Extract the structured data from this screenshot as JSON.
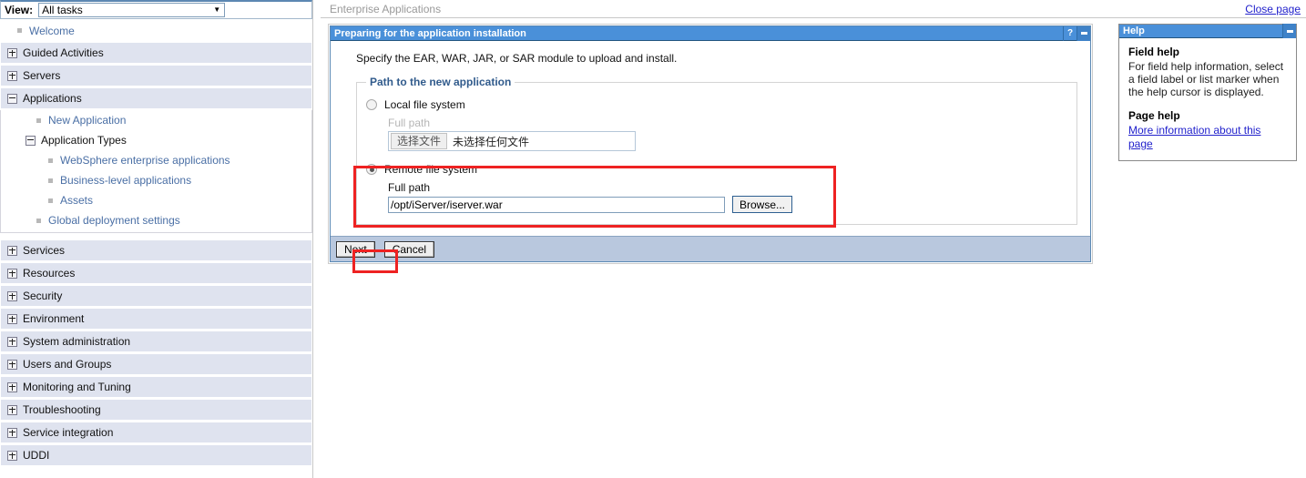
{
  "colors": {
    "panel_title_bg": "#4a90d9",
    "nav_group_bg": "#dfe3ef",
    "action_bar_bg": "#b9c8de",
    "link": "#4a6fa5",
    "annotation_red": "#ee2222",
    "legend_blue": "#315b8c"
  },
  "sidebar": {
    "view_label": "View:",
    "view_value": "All tasks",
    "caret_icon": "chevron-down-icon",
    "welcome": "Welcome",
    "groups": [
      {
        "label": "Guided Activities",
        "state": "collapsed",
        "icon": "plus-box-icon"
      },
      {
        "label": "Servers",
        "state": "collapsed",
        "icon": "plus-box-icon"
      },
      {
        "label": "Applications",
        "state": "expanded",
        "icon": "minus-box-icon"
      },
      {
        "label": "Services",
        "state": "collapsed",
        "icon": "plus-box-icon"
      },
      {
        "label": "Resources",
        "state": "collapsed",
        "icon": "plus-box-icon"
      },
      {
        "label": "Security",
        "state": "collapsed",
        "icon": "plus-box-icon"
      },
      {
        "label": "Environment",
        "state": "collapsed",
        "icon": "plus-box-icon"
      },
      {
        "label": "System administration",
        "state": "collapsed",
        "icon": "plus-box-icon"
      },
      {
        "label": "Users and Groups",
        "state": "collapsed",
        "icon": "plus-box-icon"
      },
      {
        "label": "Monitoring and Tuning",
        "state": "collapsed",
        "icon": "plus-box-icon"
      },
      {
        "label": "Troubleshooting",
        "state": "collapsed",
        "icon": "plus-box-icon"
      },
      {
        "label": "Service integration",
        "state": "collapsed",
        "icon": "plus-box-icon"
      },
      {
        "label": "UDDI",
        "state": "collapsed",
        "icon": "plus-box-icon"
      }
    ],
    "applications_children": {
      "new_application": "New Application",
      "application_types": "Application Types",
      "types": [
        "WebSphere enterprise applications",
        "Business-level applications",
        "Assets"
      ],
      "global_deployment_settings": "Global deployment settings"
    }
  },
  "topbar": {
    "breadcrumb": "Enterprise Applications",
    "close_page": "Close page"
  },
  "task_panel": {
    "title": "Preparing for the application installation",
    "help_icon": "question-mark-icon",
    "help_icon_glyph": "?",
    "minimize_icon": "minimize-icon",
    "instruction": "Specify the EAR, WAR, JAR, or SAR module to upload and install.",
    "fieldset_legend": "Path to the new application",
    "local": {
      "radio_label": "Local file system",
      "selected": false,
      "field_label": "Full path",
      "file_button": "选择文件",
      "file_status": "未选择任何文件"
    },
    "remote": {
      "radio_label": "Remote file system",
      "selected": true,
      "field_label": "Full path",
      "path_value": "/opt/iServer/iserver.war",
      "path_placeholder": "",
      "browse_button": "Browse..."
    },
    "actions": {
      "next": "Next",
      "cancel": "Cancel"
    }
  },
  "help_panel": {
    "title": "Help",
    "minimize_icon": "minimize-icon",
    "field_help_heading": "Field help",
    "field_help_text": "For field help information, select a field label or list marker when the help cursor is displayed.",
    "page_help_heading": "Page help",
    "page_help_link": "More information about this page"
  }
}
